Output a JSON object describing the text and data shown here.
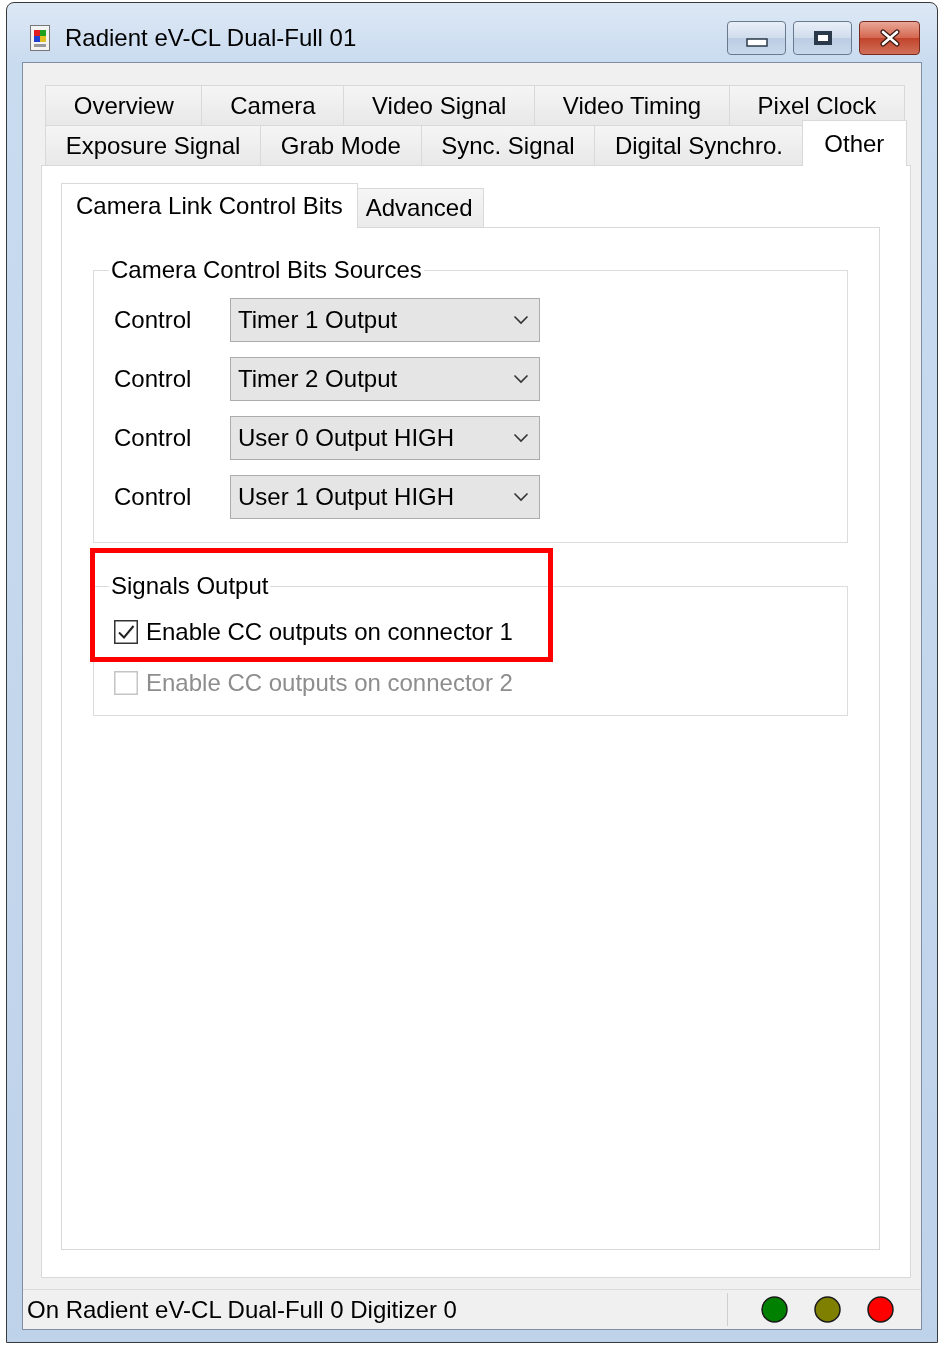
{
  "window": {
    "title": "Radient eV-CL Dual-Full 01"
  },
  "tab_rows": [
    {
      "tabs": [
        {
          "label": "Overview",
          "selected": false
        },
        {
          "label": "Camera",
          "selected": false
        },
        {
          "label": "Video Signal",
          "selected": false
        },
        {
          "label": "Video Timing",
          "selected": false
        },
        {
          "label": "Pixel Clock",
          "selected": false
        }
      ]
    },
    {
      "tabs": [
        {
          "label": "Exposure Signal",
          "selected": false
        },
        {
          "label": "Grab Mode",
          "selected": false
        },
        {
          "label": "Sync. Signal",
          "selected": false
        },
        {
          "label": "Digital Synchro.",
          "selected": false
        },
        {
          "label": "Other",
          "selected": true
        }
      ]
    }
  ],
  "subtabs": [
    {
      "label": "Camera Link Control Bits",
      "selected": true
    },
    {
      "label": "Advanced",
      "selected": false
    }
  ],
  "control_bits": {
    "title": "Camera Control Bits Sources",
    "rows": [
      {
        "label": "Control",
        "value": "Timer 1 Output"
      },
      {
        "label": "Control",
        "value": "Timer 2 Output"
      },
      {
        "label": "Control",
        "value": "User 0 Output HIGH"
      },
      {
        "label": "Control",
        "value": "User 1 Output HIGH"
      }
    ]
  },
  "signals_output": {
    "title": "Signals Output",
    "highlight": true,
    "checkboxes": [
      {
        "label": "Enable CC outputs on connector 1",
        "checked": true,
        "disabled": false
      },
      {
        "label": "Enable CC outputs on connector 2",
        "checked": false,
        "disabled": true
      }
    ]
  },
  "status_bar": {
    "text": "On Radient eV-CL Dual-Full 0 Digitizer 0",
    "lights": [
      {
        "color": "#008000"
      },
      {
        "color": "#808000"
      },
      {
        "color": "#ff0000"
      }
    ]
  }
}
